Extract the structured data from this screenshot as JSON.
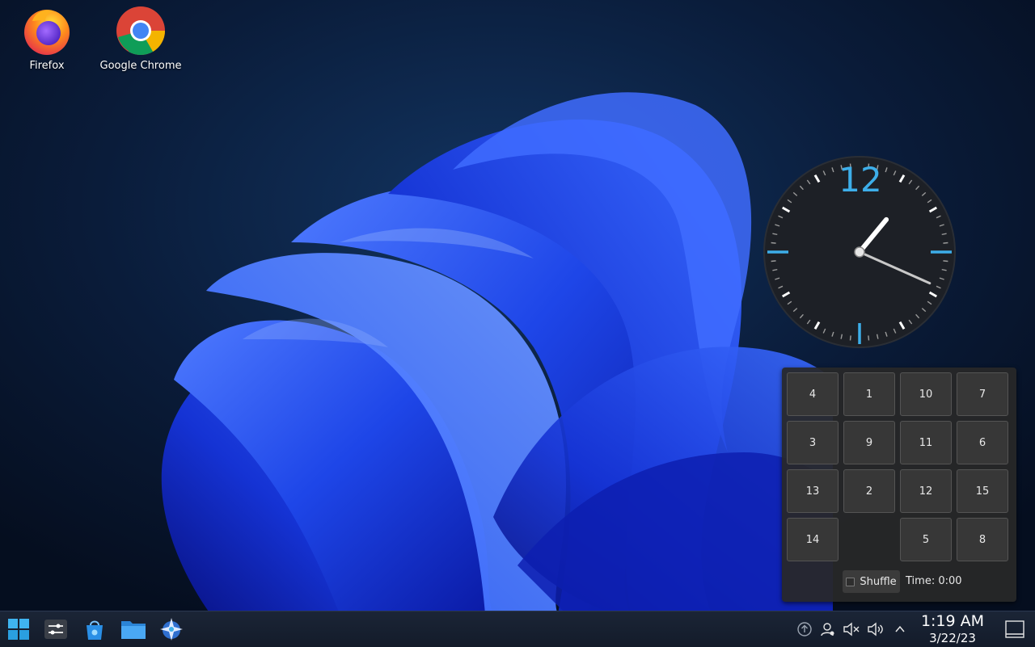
{
  "desktop": {
    "icons": [
      {
        "label": "Firefox",
        "icon": "firefox-icon"
      },
      {
        "label": "Google Chrome",
        "icon": "chrome-icon"
      }
    ]
  },
  "analog_clock": {
    "hour_numeral": "12",
    "hour": 1,
    "minute": 19,
    "accent": "#3daee9"
  },
  "puzzle": {
    "tiles": [
      "4",
      "1",
      "10",
      "7",
      "3",
      "9",
      "11",
      "6",
      "13",
      "2",
      "12",
      "15",
      "14",
      "",
      "5",
      "8"
    ],
    "shuffle_label": "Shuffle",
    "time_label": "Time: 0:00"
  },
  "taskbar": {
    "launchers": [
      {
        "name": "application-launcher",
        "icon": "windows-start-icon"
      },
      {
        "name": "system-settings",
        "icon": "settings-sliders-icon"
      },
      {
        "name": "discover-store",
        "icon": "store-bag-icon"
      },
      {
        "name": "file-manager",
        "icon": "folder-icon"
      },
      {
        "name": "kde-connect",
        "icon": "star-app-icon"
      }
    ],
    "tray": [
      "updates-icon",
      "user-status-icon",
      "mute-icon",
      "volume-icon",
      "expand-tray-icon"
    ],
    "time": "1:19 AM",
    "date": "3/22/23"
  },
  "colors": {
    "accent": "#3daee9",
    "wallpaper_dark": "#071427",
    "bloom_blue": "#1f46e6"
  }
}
